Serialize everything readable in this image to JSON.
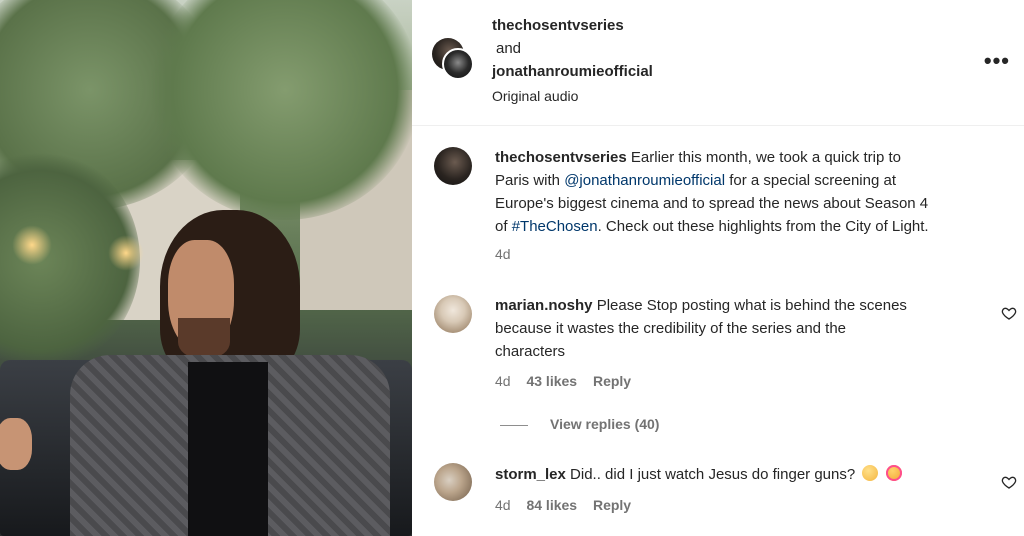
{
  "header": {
    "user1": "thechosentvseries",
    "and": "and",
    "user2": "jonathanroumieofficial",
    "audio": "Original audio",
    "more_icon": "more-horizontal-icon"
  },
  "caption": {
    "username": "thechosentvseries",
    "line1": "Earlier this month, we took a quick trip to",
    "line2_pre": "Paris with ",
    "line2_mention": "@jonathanroumieofficial",
    "line2_post": " for a special screening at",
    "line3": "Europe's biggest cinema and to spread the news about Season 4",
    "line4_pre": "of ",
    "line4_tag": "#TheChosen",
    "line4_post": ". Check out these highlights from the City of Light.",
    "time": "4d"
  },
  "comments": [
    {
      "username": "marian.noshy",
      "line1": "Please Stop posting what is behind the scenes",
      "line2": "because it wastes the credibility of the series and the",
      "line3": "characters",
      "time": "4d",
      "likes": "43 likes",
      "reply": "Reply",
      "view_replies": "View replies (40)"
    },
    {
      "username": "storm_lex",
      "text": "Did.. did I just watch Jesus do finger guns?",
      "emojis": [
        "thinking-face-emoji",
        "love-face-emoji"
      ],
      "time": "4d",
      "likes": "84 likes",
      "reply": "Reply"
    }
  ],
  "colors": {
    "link": "#00376b",
    "meta": "#737373",
    "divider": "#efefef"
  }
}
